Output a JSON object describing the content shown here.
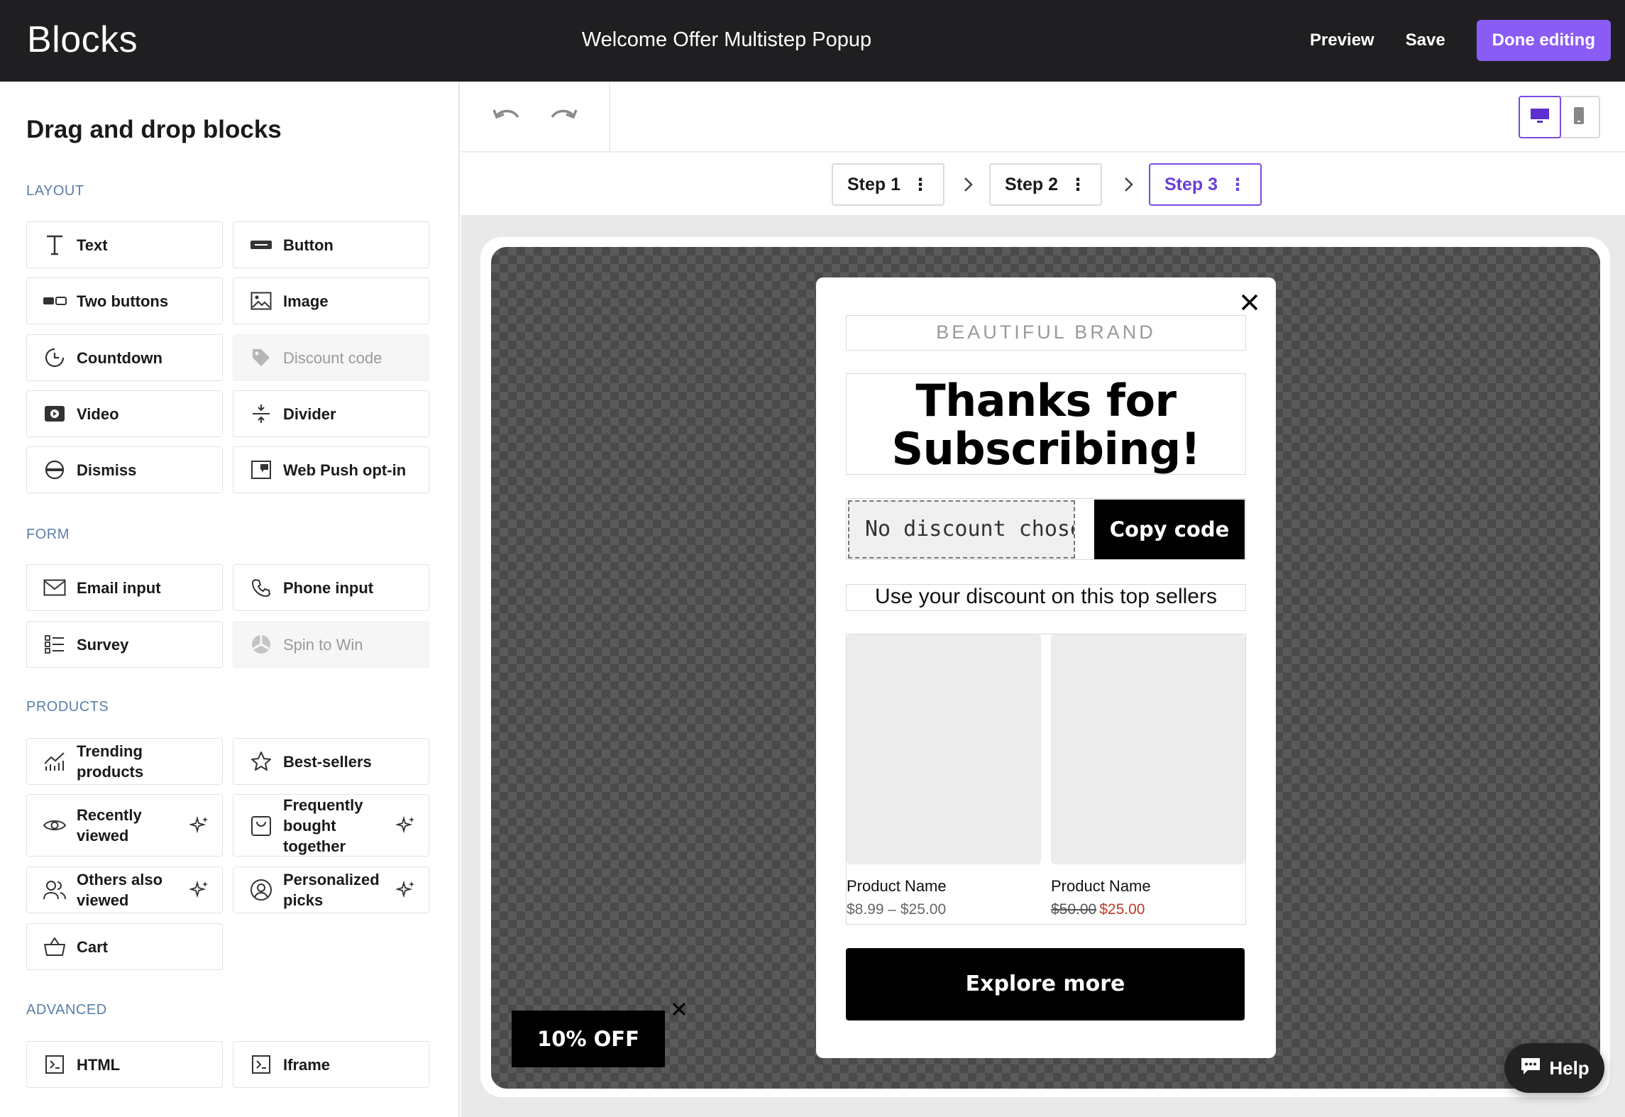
{
  "topbar": {
    "brand": "Blocks",
    "title": "Welcome Offer Multistep Popup",
    "preview_label": "Preview",
    "save_label": "Save",
    "done_label": "Done editing"
  },
  "sidebar": {
    "heading": "Drag and drop blocks",
    "sections": {
      "layout": "LAYOUT",
      "form": "FORM",
      "products": "PRODUCTS",
      "advanced": "ADVANCED"
    },
    "blocks": {
      "text": "Text",
      "button": "Button",
      "two_buttons": "Two buttons",
      "image": "Image",
      "countdown": "Countdown",
      "discount_code": "Discount code",
      "video": "Video",
      "divider": "Divider",
      "dismiss": "Dismiss",
      "web_push": "Web Push opt-in",
      "email_input": "Email input",
      "phone_input": "Phone input",
      "survey": "Survey",
      "spin_to_win": "Spin to Win",
      "trending_1": "Trending",
      "trending_2": "products",
      "best_sellers": "Best-sellers",
      "recently_1": "Recently",
      "recently_2": "viewed",
      "fbt_1": "Frequently",
      "fbt_2": "bought",
      "fbt_3": "together",
      "others_1": "Others also",
      "others_2": "viewed",
      "personalized_1": "Personalized",
      "personalized_2": "picks",
      "cart": "Cart",
      "html": "HTML",
      "iframe": "Iframe"
    }
  },
  "steps": [
    {
      "label": "Step 1"
    },
    {
      "label": "Step 2"
    },
    {
      "label": "Step 3"
    }
  ],
  "popup": {
    "brand": "BEAUTIFUL BRAND",
    "headline_1": "Thanks for",
    "headline_2": "Subscribing!",
    "code_value": "No discount chosen",
    "copy_label": "Copy code",
    "subline": "Use your discount on this top sellers",
    "products": [
      {
        "name": "Product Name",
        "price": "$8.99 – $25.00"
      },
      {
        "name": "Product Name",
        "old_price": "$50.00",
        "sale_price": "$25.00"
      }
    ],
    "cta": "Explore more"
  },
  "teaser": "10% OFF",
  "help_label": "Help",
  "colors": {
    "accent": "#8a5cf6",
    "topbar": "#1f1f21",
    "sale": "#c0392b"
  }
}
